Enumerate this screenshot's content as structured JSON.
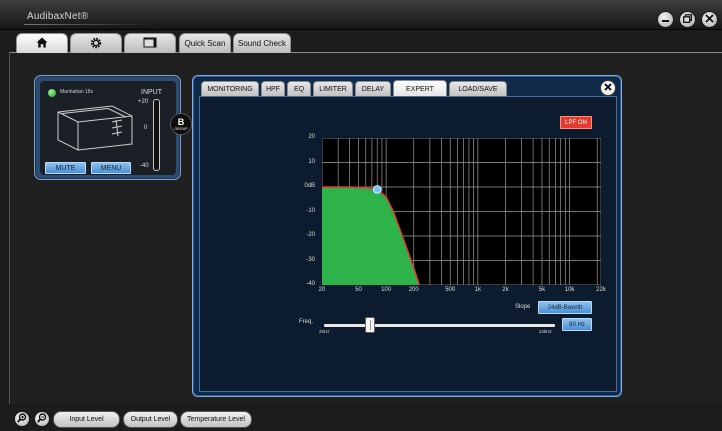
{
  "app": {
    "title": "AudibaxNet®"
  },
  "window_controls": {
    "minimize_icon": "minimize-icon",
    "restore_icon": "restore-icon",
    "close_icon": "close-icon"
  },
  "top_tabs": {
    "home_icon": "home-icon",
    "settings_icon": "gear-icon",
    "window_icon": "window-icon",
    "quick_scan": "Quick Scan",
    "sound_check": "Sound Check"
  },
  "device": {
    "name": "Manhattan 18s",
    "input_label": "INPUT",
    "meter_top": "+20",
    "meter_mid": "0",
    "meter_bottom": "-40",
    "mute": "MUTE",
    "menu": "MENU",
    "group_letter": "B",
    "group_word": "GROUP",
    "status_color": "#22c022"
  },
  "panel": {
    "tabs": [
      "MONITORING",
      "HPF",
      "EQ",
      "LIMITER",
      "DELAY",
      "EXPERT",
      "LOAD/SAVE"
    ],
    "active_tab": "EXPERT",
    "lpf_button": "LPF ON",
    "slope_label": "Slope",
    "slope_value": "24dB-Bworth",
    "freq_label": "Freq.",
    "freq_min": "20Hz",
    "freq_max": "22kHz",
    "freq_value": "80 Hz",
    "accent_color": "#e33a2e",
    "fill_color": "#2db34a"
  },
  "chart_data": {
    "type": "line",
    "title": "",
    "xlabel": "",
    "ylabel": "",
    "x_scale": "log",
    "xlim": [
      20,
      22000
    ],
    "ylim": [
      -40,
      20
    ],
    "x_ticks": [
      20,
      50,
      100,
      200,
      500,
      1000,
      2000,
      5000,
      10000,
      22000
    ],
    "x_tick_labels": [
      "20",
      "50",
      "100",
      "200",
      "500",
      "1k",
      "2k",
      "5k",
      "10k",
      "22k"
    ],
    "y_ticks": [
      20,
      10,
      0,
      -10,
      -20,
      -30,
      -40
    ],
    "y_tick_labels": [
      "20",
      "10",
      "0dB",
      "-10",
      "-20",
      "-30",
      "-40"
    ],
    "grid": true,
    "series": [
      {
        "x": [
          20,
          40,
          60,
          80,
          100,
          120,
          150,
          200,
          230
        ],
        "y": [
          0,
          0,
          -0.3,
          -1,
          -4,
          -10,
          -20,
          -33,
          -40
        ],
        "filled": true
      }
    ],
    "handle": {
      "x": 80,
      "y": -1
    }
  },
  "bottom_bar": {
    "zoom_in_icon": "zoom-in-icon",
    "zoom_out_icon": "zoom-out-icon",
    "input_level": "Input Level",
    "output_level": "Output Level",
    "temperature_level": "Temperature Level"
  }
}
